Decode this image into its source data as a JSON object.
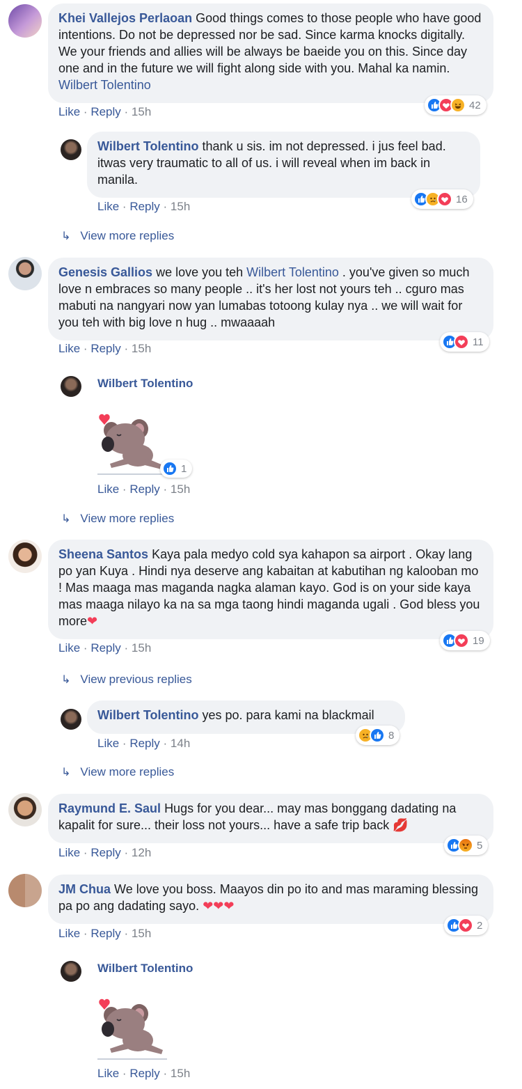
{
  "comments": [
    {
      "name": "Khei Vallejos Perlaoan",
      "text": "Good things comes to those people who have good intentions. Do not be depressed nor be sad. Since karma knocks digitally. We your friends and allies will be always be baeide you on this. Since day one and in the future we will fight along side with you. Mahal ka namin.",
      "mention": "Wilbert Tolentino",
      "like": "Like",
      "reply": "Reply",
      "time": "15h",
      "reaction_count": "42",
      "reactions": [
        "like",
        "love",
        "haha"
      ]
    },
    {
      "name": "Wilbert Tolentino",
      "text": "thank u sis. im not depressed. i jus feel bad. itwas very traumatic to all of us. i will reveal when im back in manila.",
      "like": "Like",
      "reply": "Reply",
      "time": "15h",
      "reaction_count": "16",
      "reactions": [
        "like",
        "sad",
        "love"
      ]
    },
    {
      "name": "Genesis Gallios",
      "text_before": "we love you teh",
      "mention": "Wilbert Tolentino",
      "text_after": ". you've given so much love n embraces so many people .. it's her lost not yours teh .. cguro mas mabuti na nangyari now yan lumabas totoong kulay nya .. we will wait for you teh with big love n hug .. mwaaaah",
      "like": "Like",
      "reply": "Reply",
      "time": "15h",
      "reaction_count": "11",
      "reactions": [
        "like",
        "love"
      ]
    },
    {
      "name": "Wilbert Tolentino",
      "like": "Like",
      "reply": "Reply",
      "time": "15h",
      "reaction_count": "1",
      "reactions": [
        "like"
      ]
    },
    {
      "name": "Sheena Santos",
      "text": "Kaya pala medyo cold sya kahapon sa airport . Okay lang po yan Kuya . Hindi nya deserve ang kabaitan at kabutihan ng kalooban mo ! Mas maaga mas maganda nagka alaman kayo. God is on your side kaya mas maaga nilayo ka na sa mga taong hindi maganda ugali . God bless you more",
      "emoji": "❤",
      "like": "Like",
      "reply": "Reply",
      "time": "15h",
      "reaction_count": "19",
      "reactions": [
        "like",
        "love"
      ]
    },
    {
      "name": "Wilbert Tolentino",
      "text": "yes po. para kami na blackmail",
      "like": "Like",
      "reply": "Reply",
      "time": "14h",
      "reaction_count": "8",
      "reactions": [
        "sad",
        "like"
      ]
    },
    {
      "name": "Raymund E. Saul",
      "text": "Hugs for you dear... may mas bonggang dadating na kapalit for sure... their loss not yours... have a safe trip back",
      "emoji": "💋",
      "like": "Like",
      "reply": "Reply",
      "time": "12h",
      "reaction_count": "5",
      "reactions": [
        "like",
        "angry"
      ]
    },
    {
      "name": "JM Chua",
      "text": "We love you boss. Maayos din po ito and mas maraming blessing pa po ang dadating sayo.",
      "emoji": "❤❤❤",
      "like": "Like",
      "reply": "Reply",
      "time": "15h",
      "reaction_count": "2",
      "reactions": [
        "like",
        "love"
      ]
    },
    {
      "name": "Wilbert Tolentino",
      "like": "Like",
      "reply": "Reply",
      "time": "15h"
    }
  ],
  "view_more_replies": "View more replies",
  "view_previous_replies": "View previous replies",
  "separator": "·",
  "colors": {
    "link": "#385898",
    "bubble": "#f0f2f5",
    "like": "#1877f2",
    "love": "#f33e58",
    "meta": "#7c8189"
  }
}
